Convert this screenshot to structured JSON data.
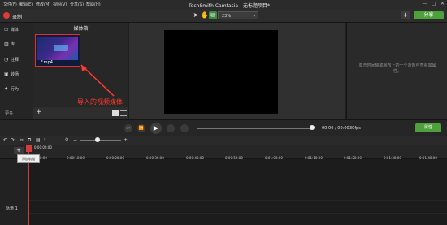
{
  "menubar": {
    "items": [
      "文件(F)",
      "编辑(E)",
      "修改(M)",
      "视图(V)",
      "分享(S)",
      "帮助(H)"
    ],
    "title": "TechSmith Camtasia - 无标题项目*"
  },
  "toolbar": {
    "record_label": "录制",
    "zoom_value": "23%",
    "share_label": "分享"
  },
  "sidebar": {
    "items": [
      {
        "label": "媒体",
        "icon": "media-icon"
      },
      {
        "label": "库",
        "icon": "library-icon"
      },
      {
        "label": "注释",
        "icon": "annotation-icon"
      },
      {
        "label": "转场",
        "icon": "transition-icon"
      },
      {
        "label": "行为",
        "icon": "behavior-icon"
      }
    ],
    "more_label": "更多"
  },
  "media_bin": {
    "title": "媒体箱",
    "items": [
      {
        "filename": "F.mp4"
      }
    ]
  },
  "properties": {
    "hint": "单击时间轴或画布上的一个对象可查看其属性。"
  },
  "annotation": {
    "label": "导入的视频媒体",
    "color": "#ff3a2e"
  },
  "playback": {
    "time": "00:00 / 00:00",
    "fps": "30fps",
    "properties_label": "属性"
  },
  "timeline": {
    "playhead_time": "0:00:00;00",
    "add_track_tooltip": "添加轨道",
    "ticks": [
      "0:00:00;00",
      "0:00:10;00",
      "0:00:20;00",
      "0:00:30;00",
      "0:00:40;00",
      "0:00:50;00",
      "0:01:00;00",
      "0:01:10;00",
      "0:01:20;00",
      "0:01:30;00",
      "0:01:40;00"
    ],
    "track_label": "轨道 1"
  },
  "colors": {
    "accent_green": "#4ea03a",
    "record_red": "#e03b3b",
    "playhead_red": "#d43c3c"
  }
}
